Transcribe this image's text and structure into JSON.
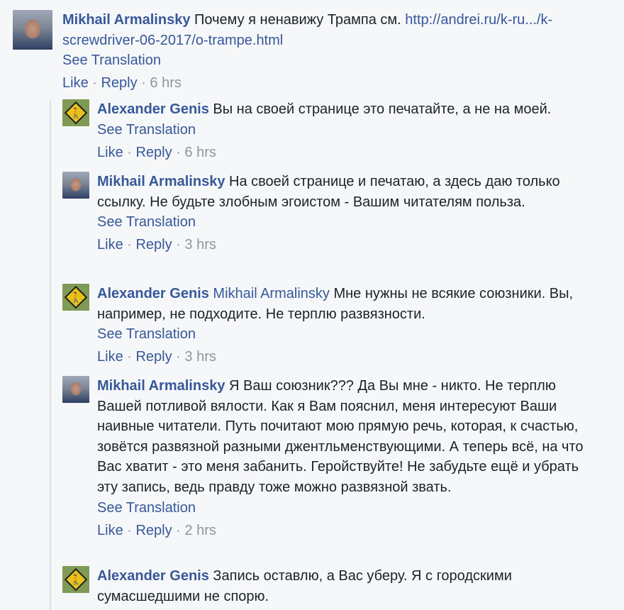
{
  "thread": {
    "comments": [
      {
        "author": "Mikhail Armalinsky",
        "avatar_icon": "man-portrait-icon",
        "text": "Почему я ненавижу Трампа см.",
        "link": "http://andrei.ru/k-ru.../k-screwdriver-06-2017/o-trampe.html",
        "see_translation": "See Translation",
        "like": "Like",
        "reply": "Reply",
        "sep": " · ",
        "time": "6 hrs"
      }
    ],
    "replies": [
      {
        "author": "Alexander Genis",
        "avatar_icon": "pedestrian-sign-icon",
        "text": "Вы на своей странице это печатайте, а не на моей.",
        "see_translation": "See Translation",
        "like": "Like",
        "reply": "Reply",
        "sep": " · ",
        "time": "6 hrs"
      },
      {
        "author": "Mikhail Armalinsky",
        "avatar_icon": "man-portrait-icon",
        "text": "На своей странице и печатаю, а здесь даю только ссылку. Не будьте злобным эгоистом - Вашим читателям польза.",
        "see_translation": "See Translation",
        "like": "Like",
        "reply": "Reply",
        "sep": " · ",
        "time": "3 hrs"
      },
      {
        "author": "Alexander Genis",
        "avatar_icon": "pedestrian-sign-icon",
        "mention": "Mikhail Armalinsky",
        "text": "Мне нужны не всякие союзники. Вы, например, не подходите. Не терплю развязности.",
        "see_translation": "See Translation",
        "like": "Like",
        "reply": "Reply",
        "sep": " · ",
        "time": "3 hrs"
      },
      {
        "author": "Mikhail Armalinsky",
        "avatar_icon": "man-portrait-icon",
        "text": "Я Ваш союзник??? Да Вы мне - никто. Не терплю Вашей потливой вялости. Как я Вам пояснил, меня интересуют Ваши наивные читатели. Путь почитают мою прямую речь, которая, к счастью, зовётся развязной разными джентльменствующими. А теперь всё, на что Вас хватит - это меня забанить. Геройствуйте! Не забудьте ещё и убрать эту запись, ведь правду тоже можно развязной звать.",
        "see_translation": "See Translation",
        "like": "Like",
        "reply": "Reply",
        "sep": " · ",
        "time": "2 hrs"
      },
      {
        "author": "Alexander Genis",
        "avatar_icon": "pedestrian-sign-icon",
        "text": "Запись оставлю, а Вас уберу. Я с городскими сумасшедшими не спорю."
      }
    ]
  }
}
